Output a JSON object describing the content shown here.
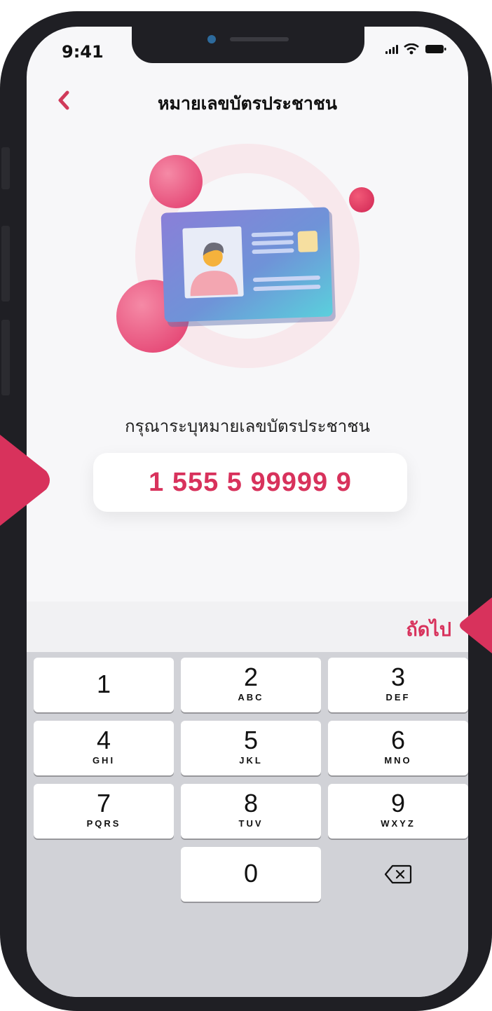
{
  "status": {
    "time": "9:41"
  },
  "nav": {
    "back_icon": "chevron-left-icon",
    "title": "หมายเลขบัตรประชาชน"
  },
  "form": {
    "prompt": "กรุณาระบุหมายเลขบัตรประชาชน",
    "id_value": "1 555 5 99999 9"
  },
  "accessory": {
    "next_label": "ถัดไป"
  },
  "keyboard": {
    "keys": [
      {
        "num": "1",
        "sub": ""
      },
      {
        "num": "2",
        "sub": "ABC"
      },
      {
        "num": "3",
        "sub": "DEF"
      },
      {
        "num": "4",
        "sub": "GHI"
      },
      {
        "num": "5",
        "sub": "JKL"
      },
      {
        "num": "6",
        "sub": "MNO"
      },
      {
        "num": "7",
        "sub": "PQRS"
      },
      {
        "num": "8",
        "sub": "TUV"
      },
      {
        "num": "9",
        "sub": "WXYZ"
      },
      {
        "num": "0",
        "sub": ""
      }
    ],
    "delete_icon": "backspace-icon"
  },
  "colors": {
    "accent": "#D8325C",
    "screen_bg": "#F7F7F9",
    "keyboard_bg": "#D1D2D7"
  }
}
